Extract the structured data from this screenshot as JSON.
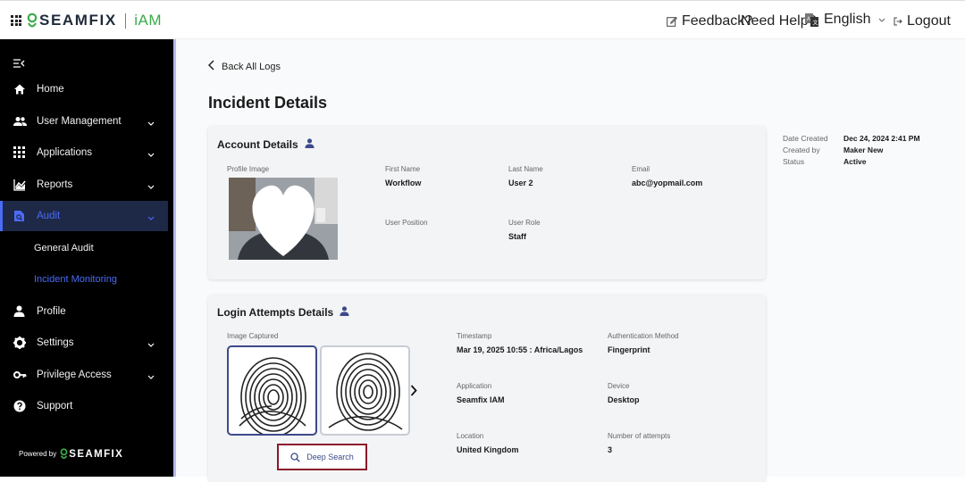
{
  "brand": {
    "name": "SEAMFIX",
    "product": "iAM"
  },
  "topbar": {
    "feedback_label": "Feedback?",
    "help_label": "Need Help?",
    "language_label": "English",
    "logout_label": "Logout"
  },
  "sidebar": {
    "items": [
      {
        "label": "Home"
      },
      {
        "label": "User Management"
      },
      {
        "label": "Applications"
      },
      {
        "label": "Reports"
      },
      {
        "label": "Audit"
      },
      {
        "label": "Profile"
      },
      {
        "label": "Settings"
      },
      {
        "label": "Privilege Access"
      },
      {
        "label": "Support"
      }
    ],
    "audit_sub": [
      {
        "label": "General Audit"
      },
      {
        "label": "Incident Monitoring"
      }
    ],
    "powered_by": "Powered by",
    "powered_brand": "SEAMFIX"
  },
  "main": {
    "back_label": "Back All Logs",
    "title": "Incident Details",
    "account": {
      "title": "Account Details",
      "profile_image_label": "Profile Image",
      "first_name_label": "First Name",
      "first_name": "Workflow",
      "last_name_label": "Last Name",
      "last_name": "User 2",
      "email_label": "Email",
      "email": "abc@yopmail.com",
      "user_position_label": "User Position",
      "user_position": "",
      "user_role_label": "User Role",
      "user_role": "Staff"
    },
    "login": {
      "title": "Login Attempts Details",
      "image_captured_label": "Image Captured",
      "timestamp_label": "Timestamp",
      "timestamp": "Mar 19, 2025 10:55 : Africa/Lagos",
      "auth_method_label": "Authentication Method",
      "auth_method": "Fingerprint",
      "application_label": "Application",
      "application": "Seamfix IAM",
      "device_label": "Device",
      "device": "Desktop",
      "location_label": "Location",
      "location": "United Kingdom",
      "attempts_label": "Number of attempts",
      "attempts": "3",
      "deep_search_label": "Deep Search"
    },
    "meta": {
      "date_created_label": "Date Created",
      "date_created": "Dec 24, 2024 2:41 PM",
      "created_by_label": "Created by",
      "created_by": "Maker New",
      "status_label": "Status",
      "status": "Active"
    }
  },
  "colors": {
    "brand_green": "#3aaa4a",
    "accent_blue": "#4a6cf7",
    "deep_search_border": "#8b1a2b",
    "sidebar_bg": "#000000"
  }
}
